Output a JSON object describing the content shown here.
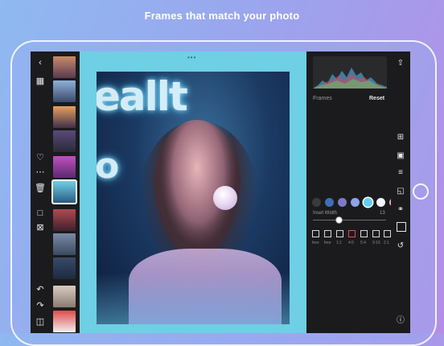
{
  "headline": "Frames that match your photo",
  "panel": {
    "section_label": "Frames",
    "reset_label": "Reset",
    "slider_label": "Inset Width",
    "slider_value": "13",
    "ratio_labels": [
      "free",
      "free",
      "1:1",
      "4:5",
      "5:4",
      "9:16",
      "2:1"
    ]
  },
  "swatch_colors": [
    "#3a3a3e",
    "#3d6fb6",
    "#7c7ac8",
    "#8fa3e6",
    "#5fd0f2",
    "#f4f6ff",
    "#f2a8b4"
  ],
  "icons": {
    "left": [
      "back-icon",
      "compare-icon",
      "heart-icon",
      "more-icon",
      "trash-icon",
      "comment-icon",
      "reject-icon",
      "undo-icon",
      "redo-icon",
      "split-view-icon"
    ],
    "right": [
      "share-icon",
      "crop-icon",
      "adjust-icon",
      "sliders-icon",
      "curves-icon",
      "color-mix-icon",
      "frame-icon",
      "history-icon",
      "info-icon"
    ]
  },
  "thumb_colors": [
    "#c98a6a",
    "#6b8fb8",
    "#3a4a6a",
    "#d98a4a",
    "#7b5a9a",
    "#4a4a5a",
    "#9a4ab0",
    "#3fa0c0",
    "#b06060",
    "#5a6a8a",
    "#2a3a5a",
    "#c0b0a0",
    "#c04040"
  ]
}
